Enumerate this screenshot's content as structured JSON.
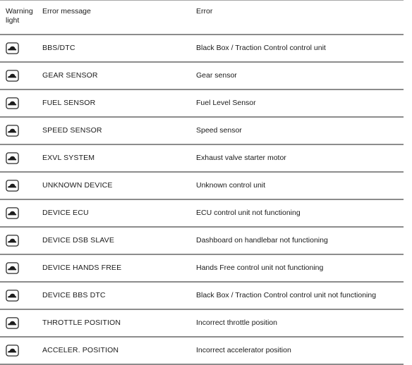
{
  "table": {
    "headers": {
      "warning_light": "Warning light",
      "error_message": "Error message",
      "error": "Error"
    },
    "icon_name": "warning-lamp-icon",
    "colors": {
      "rule": "#8c8c8c",
      "top_rule": "#a8a8a8",
      "text": "#1a1a1a",
      "background": "#ffffff"
    },
    "rows": [
      {
        "message": "BBS/DTC",
        "error": "Black Box / Traction Control control unit"
      },
      {
        "message": "GEAR SENSOR",
        "error": "Gear sensor"
      },
      {
        "message": "FUEL SENSOR",
        "error": "Fuel Level Sensor"
      },
      {
        "message": "SPEED SENSOR",
        "error": "Speed sensor"
      },
      {
        "message": "EXVL SYSTEM",
        "error": "Exhaust valve starter motor"
      },
      {
        "message": "UNKNOWN DEVICE",
        "error": "Unknown control unit"
      },
      {
        "message": "DEVICE ECU",
        "error": "ECU control unit not functioning"
      },
      {
        "message": "DEVICE DSB SLAVE",
        "error": "Dashboard on handlebar not functioning"
      },
      {
        "message": "DEVICE HANDS FREE",
        "error": "Hands Free control unit not functioning"
      },
      {
        "message": "DEVICE BBS DTC",
        "error": "Black Box / Traction Control control unit not functioning"
      },
      {
        "message": "THROTTLE POSITION",
        "error": "Incorrect throttle position"
      },
      {
        "message": "ACCELER. POSITION",
        "error": "Incorrect accelerator position"
      }
    ]
  }
}
